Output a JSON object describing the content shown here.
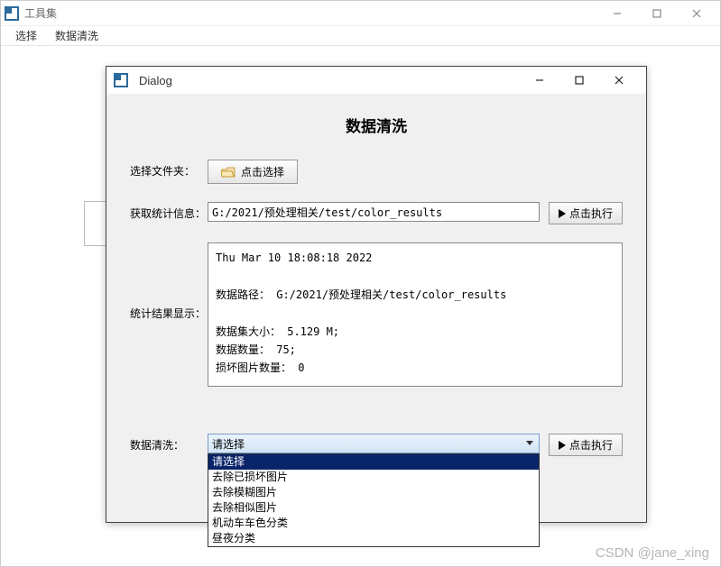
{
  "main_window": {
    "title": "工具集",
    "menu": [
      "选择",
      "数据清洗"
    ]
  },
  "dialog": {
    "title": "Dialog",
    "heading": "数据清洗",
    "rows": {
      "select_folder_label": "选择文件夹：",
      "select_folder_btn": "点击选择",
      "stats_label": "获取统计信息：",
      "stats_path": "G:/2021/预处理相关/test/color_results",
      "exec_btn": "点击执行",
      "result_label": "统计结果显示：",
      "result_text": "Thu Mar 10 18:08:18 2022\n\n数据路径： G:/2021/预处理相关/test/color_results\n\n数据集大小： 5.129 M;\n数据数量： 75;\n损坏图片数量： 0",
      "clean_label": "数据清洗："
    },
    "combo": {
      "value": "请选择",
      "options": [
        "请选择",
        "去除已损坏图片",
        "去除模糊图片",
        "去除相似图片",
        "机动车车色分类",
        "昼夜分类"
      ]
    }
  },
  "watermark": "CSDN @jane_xing"
}
